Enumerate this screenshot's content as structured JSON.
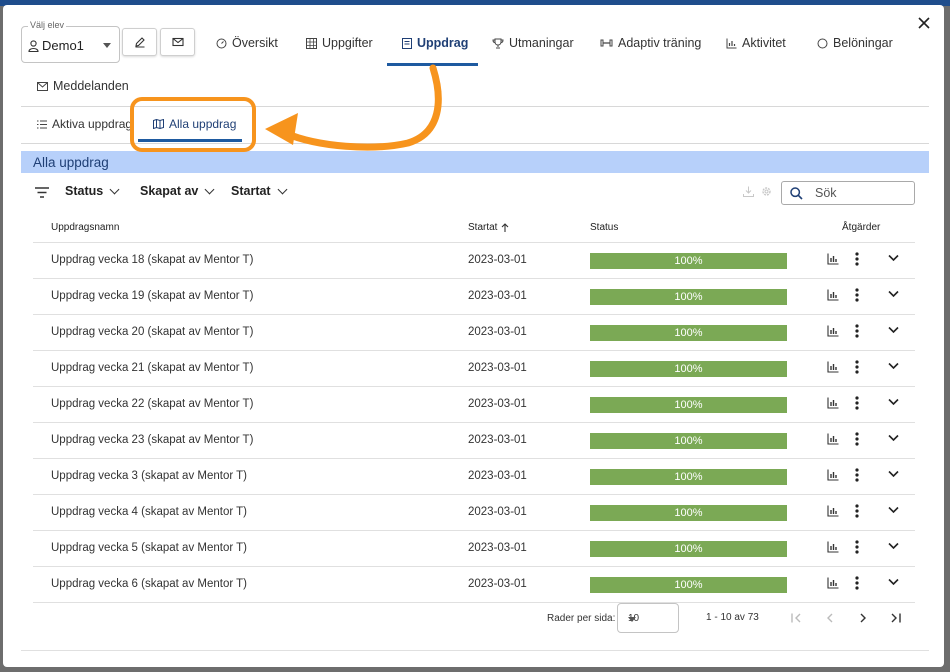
{
  "student": {
    "label": "Välj elev",
    "value": "Demo1"
  },
  "nav": {
    "tabs": [
      {
        "label": "Översikt",
        "icon": "gauge-icon"
      },
      {
        "label": "Uppgifter",
        "icon": "grid-icon"
      },
      {
        "label": "Uppdrag",
        "icon": "document-icon",
        "active": true
      },
      {
        "label": "Utmaningar",
        "icon": "trophy-icon"
      },
      {
        "label": "Adaptiv träning",
        "icon": "dumbbell-icon"
      },
      {
        "label": "Aktivitet",
        "icon": "bar-chart-icon"
      },
      {
        "label": "Belöningar",
        "icon": "circle-icon"
      },
      {
        "label": "Meddelanden",
        "icon": "envelope-icon"
      }
    ]
  },
  "subtabs": [
    {
      "label": "Aktiva uppdrag",
      "icon": "list-icon"
    },
    {
      "label": "Alla uppdrag",
      "icon": "map-icon",
      "active": true
    }
  ],
  "panel": {
    "title": "Alla uppdrag"
  },
  "filters": {
    "status": "Status",
    "created_by": "Skapat av",
    "started": "Startat"
  },
  "search": {
    "placeholder": "Sök"
  },
  "table": {
    "columns": {
      "name": "Uppdragsnamn",
      "started": "Startat",
      "status": "Status",
      "actions": "Åtgärder"
    },
    "sort": {
      "column": "Startat",
      "direction": "asc"
    },
    "rows": [
      {
        "name": "Uppdrag vecka 18 (skapat av Mentor T)",
        "started": "2023-03-01",
        "status": "100%",
        "progress": 1.0
      },
      {
        "name": "Uppdrag vecka 19 (skapat av Mentor T)",
        "started": "2023-03-01",
        "status": "100%",
        "progress": 1.0
      },
      {
        "name": "Uppdrag vecka 20 (skapat av Mentor T)",
        "started": "2023-03-01",
        "status": "100%",
        "progress": 1.0
      },
      {
        "name": "Uppdrag vecka 21 (skapat av Mentor T)",
        "started": "2023-03-01",
        "status": "100%",
        "progress": 1.0
      },
      {
        "name": "Uppdrag vecka 22 (skapat av Mentor T)",
        "started": "2023-03-01",
        "status": "100%",
        "progress": 1.0
      },
      {
        "name": "Uppdrag vecka 23 (skapat av Mentor T)",
        "started": "2023-03-01",
        "status": "100%",
        "progress": 1.0
      },
      {
        "name": "Uppdrag vecka 3 (skapat av Mentor T)",
        "started": "2023-03-01",
        "status": "100%",
        "progress": 1.0
      },
      {
        "name": "Uppdrag vecka 4 (skapat av Mentor T)",
        "started": "2023-03-01",
        "status": "100%",
        "progress": 1.0
      },
      {
        "name": "Uppdrag vecka 5 (skapat av Mentor T)",
        "started": "2023-03-01",
        "status": "100%",
        "progress": 1.0
      },
      {
        "name": "Uppdrag vecka 6 (skapat av Mentor T)",
        "started": "2023-03-01",
        "status": "100%",
        "progress": 1.0
      }
    ]
  },
  "pagination": {
    "rows_per_page_label": "Rader per sida:",
    "rows_per_page": "10",
    "range": "1 - 10 av 73"
  },
  "colors": {
    "accent": "#1e5aa0",
    "panel_header_bg": "#b7d0fa",
    "progress": "#7ba955",
    "highlight": "#f7941d"
  }
}
